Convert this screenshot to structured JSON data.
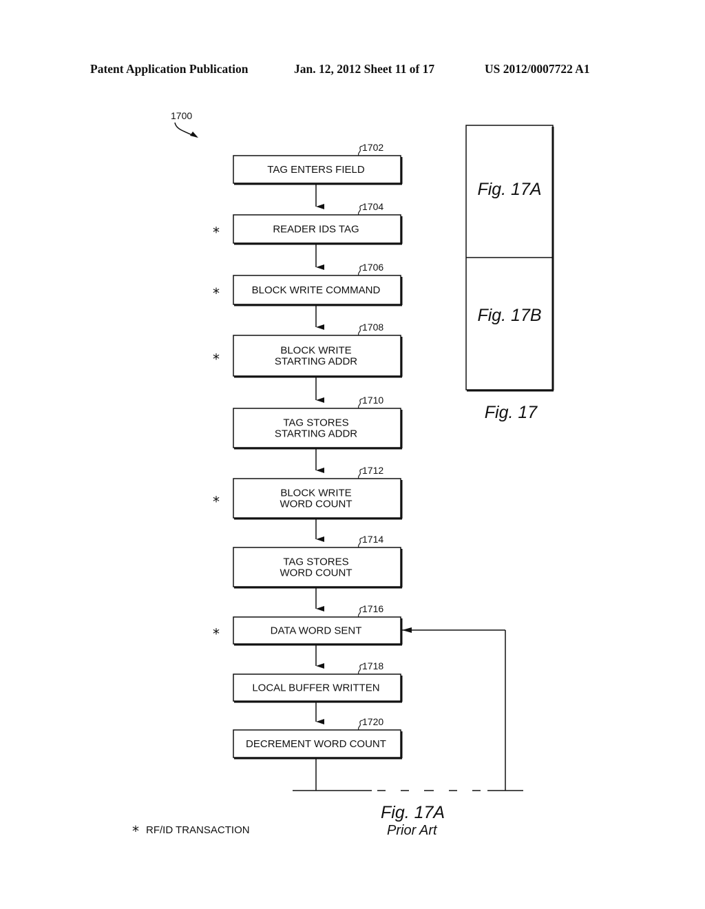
{
  "header": {
    "publication": "Patent Application Publication",
    "date_sheet": "Jan. 12, 2012  Sheet 11 of 17",
    "pub_number": "US 2012/0007722 A1"
  },
  "diagram": {
    "ref_main": "1700",
    "steps": [
      {
        "ref": "1702",
        "lines": [
          "TAG ENTERS FIELD"
        ],
        "rfid": false
      },
      {
        "ref": "1704",
        "lines": [
          "READER IDS TAG"
        ],
        "rfid": true
      },
      {
        "ref": "1706",
        "lines": [
          "BLOCK WRITE COMMAND"
        ],
        "rfid": true
      },
      {
        "ref": "1708",
        "lines": [
          "BLOCK WRITE",
          "STARTING ADDR"
        ],
        "rfid": true
      },
      {
        "ref": "1710",
        "lines": [
          "TAG STORES",
          "STARTING ADDR"
        ],
        "rfid": false
      },
      {
        "ref": "1712",
        "lines": [
          "BLOCK WRITE",
          "WORD COUNT"
        ],
        "rfid": true
      },
      {
        "ref": "1714",
        "lines": [
          "TAG STORES",
          "WORD COUNT"
        ],
        "rfid": false
      },
      {
        "ref": "1716",
        "lines": [
          "DATA WORD SENT"
        ],
        "rfid": true
      },
      {
        "ref": "1718",
        "lines": [
          "LOCAL BUFFER WRITTEN"
        ],
        "rfid": false
      },
      {
        "ref": "1720",
        "lines": [
          "DECREMENT WORD COUNT"
        ],
        "rfid": false
      }
    ],
    "loop_back_to": "1716",
    "star_symbol": "*",
    "legend": "RF/ID TRANSACTION",
    "figure_label": "Fig. 17A",
    "figure_sublabel": "Prior Art"
  },
  "overview": {
    "parts": [
      "Fig. 17A",
      "Fig. 17B"
    ],
    "label": "Fig. 17"
  }
}
